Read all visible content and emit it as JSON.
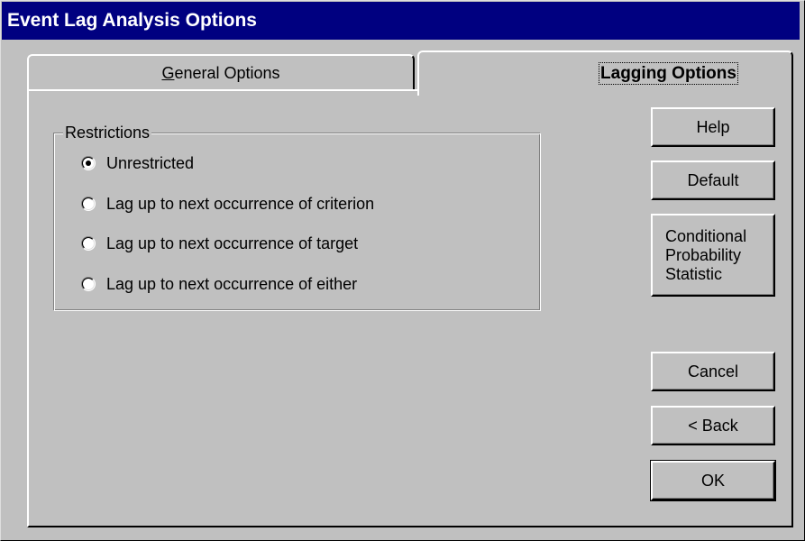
{
  "window": {
    "title": "Event Lag Analysis Options"
  },
  "tabs": [
    {
      "label_prefix": "",
      "label_access": "G",
      "label_rest": "eneral Options",
      "active": false
    },
    {
      "label": "Lagging Options",
      "active": true
    }
  ],
  "restrictions": {
    "legend": "Restrictions",
    "options": [
      {
        "label": "Unrestricted",
        "checked": true
      },
      {
        "label": "Lag up to next occurrence of criterion",
        "checked": false
      },
      {
        "label": "Lag up to next occurrence of target",
        "checked": false
      },
      {
        "label": "Lag up to next occurrence of either",
        "checked": false
      }
    ]
  },
  "buttons": {
    "help": "Help",
    "default": "Default",
    "conditional": "Conditional\nProbability\nStatistic",
    "cancel": "Cancel",
    "back": "< Back",
    "ok": "OK"
  }
}
